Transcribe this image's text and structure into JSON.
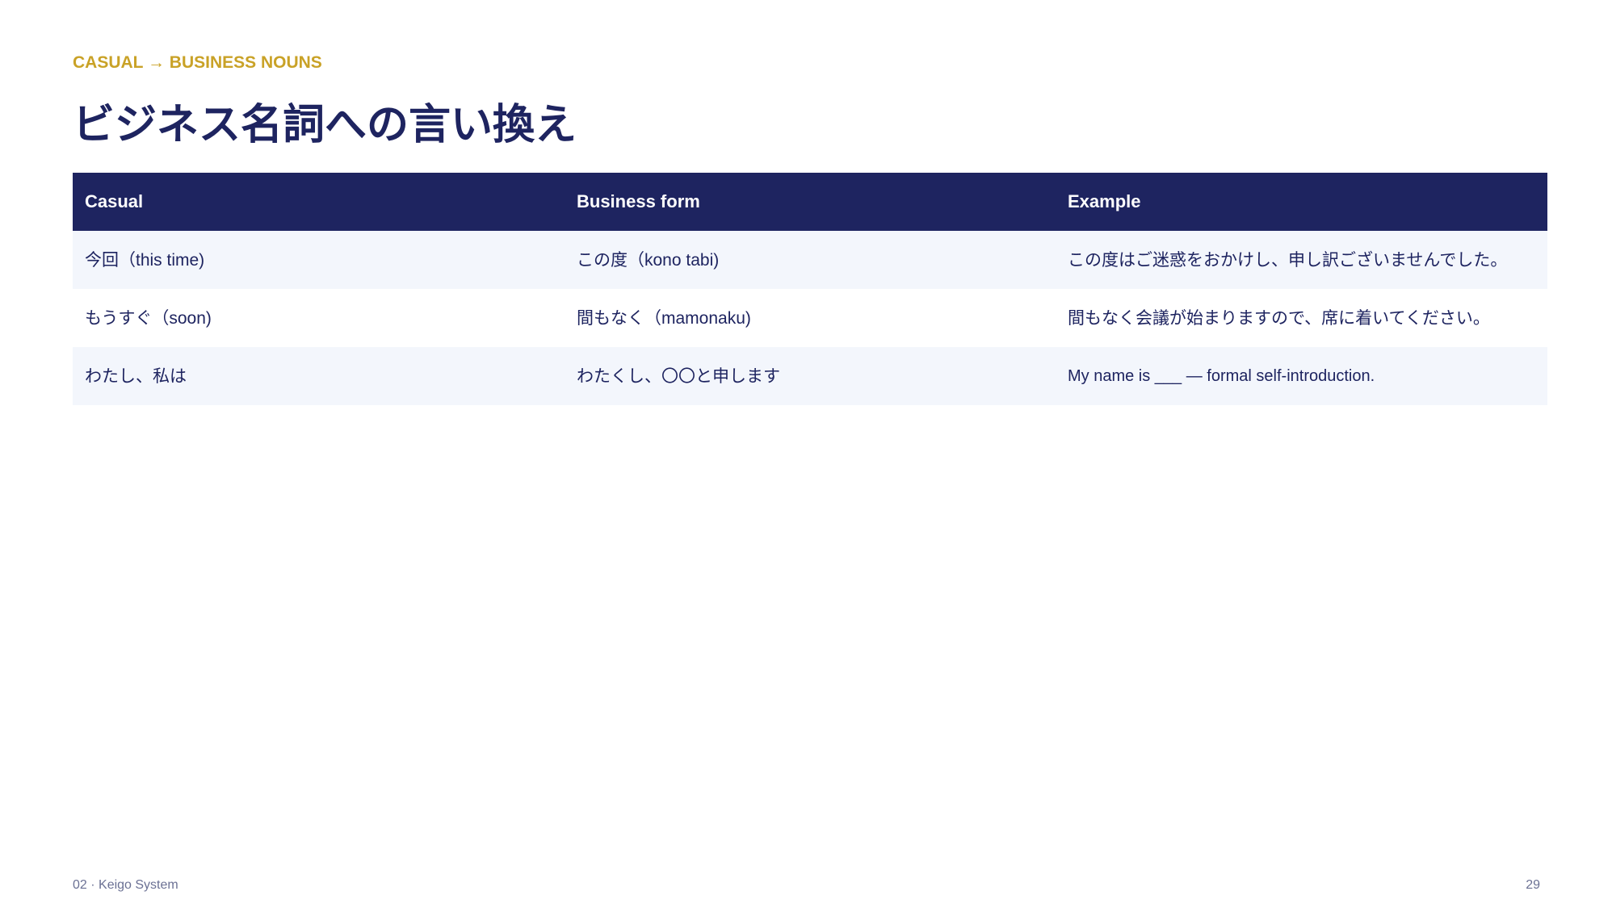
{
  "eyebrow": "CASUAL → BUSINESS NOUNS",
  "title": "ビジネス名詞への言い換え",
  "table": {
    "headers": [
      "Casual",
      "Business form",
      "Example"
    ],
    "rows": [
      [
        "今回（this time)",
        "この度（kono tabi)",
        "この度はご迷惑をおかけし、申し訳ございませんでした。"
      ],
      [
        "もうすぐ（soon)",
        "間もなく（mamonaku)",
        "間もなく会議が始まりますので、席に着いてください。"
      ],
      [
        "わたし、私は",
        "わたくし、〇〇と申します",
        "My name is ___ — formal self-introduction."
      ]
    ]
  },
  "footer": {
    "section": "02 · Keigo System",
    "page_number": "29"
  },
  "colors": {
    "navy": "#1e2460",
    "gold": "#c9a227",
    "row_alt": "#f3f6fc"
  }
}
